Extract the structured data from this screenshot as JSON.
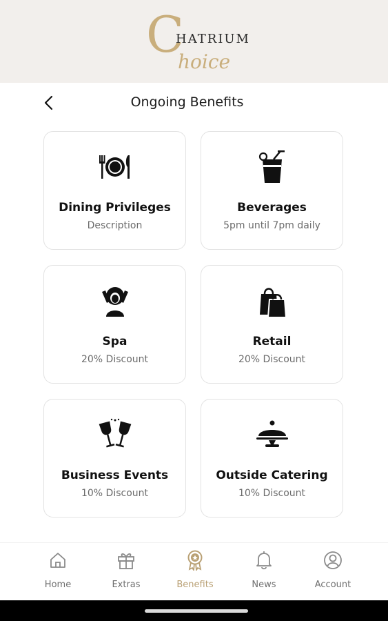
{
  "brand": {
    "logo_letter": "C",
    "logo_top": "HATRIUM",
    "logo_bottom": "hoice",
    "colors": {
      "gold": "#c9ae7c",
      "header_bg": "#f2efec"
    }
  },
  "header": {
    "title": "Ongoing Benefits",
    "back_icon": "chevron-left-icon"
  },
  "benefits": [
    {
      "title": "Dining Privileges",
      "subtitle": "Description",
      "icon": "plate-cutlery-icon"
    },
    {
      "title": "Beverages",
      "subtitle": "5pm until 7pm daily",
      "icon": "cocktail-glass-icon"
    },
    {
      "title": "Spa",
      "subtitle": "20% Discount",
      "icon": "spa-person-icon"
    },
    {
      "title": "Retail",
      "subtitle": "20% Discount",
      "icon": "shopping-bags-icon"
    },
    {
      "title": "Business Events",
      "subtitle": "10% Discount",
      "icon": "wine-glasses-toast-icon"
    },
    {
      "title": "Outside Catering",
      "subtitle": "10% Discount",
      "icon": "food-cloche-icon"
    }
  ],
  "nav": {
    "active": "Benefits",
    "items": [
      {
        "label": "Home",
        "icon": "home-icon"
      },
      {
        "label": "Extras",
        "icon": "gift-icon"
      },
      {
        "label": "Benefits",
        "icon": "award-badge-icon"
      },
      {
        "label": "News",
        "icon": "bell-icon"
      },
      {
        "label": "Account",
        "icon": "user-circle-icon"
      }
    ],
    "colors": {
      "active": "#b9a074",
      "inactive": "#6f6f6f"
    }
  }
}
